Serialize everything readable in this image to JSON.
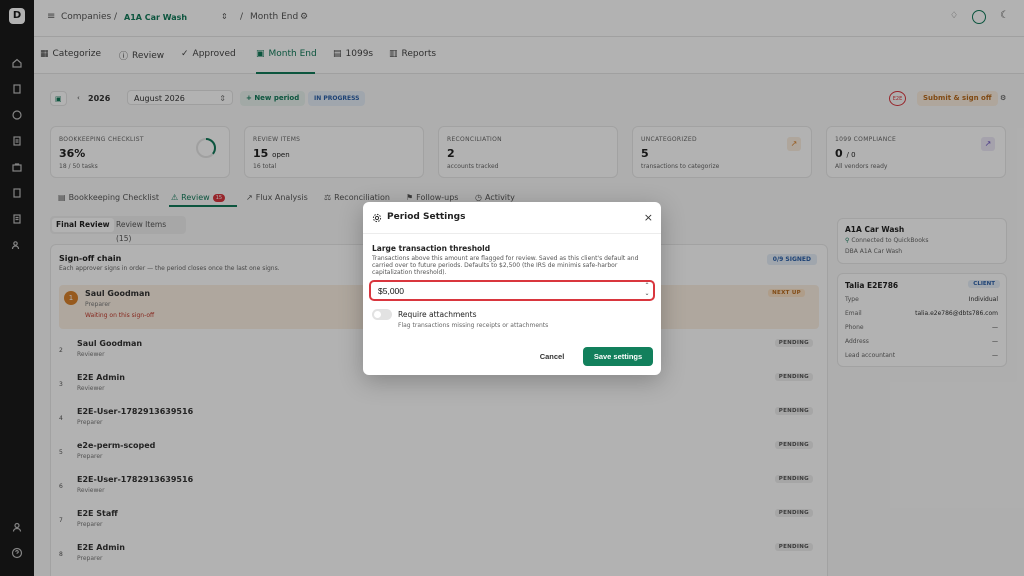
{
  "breadcrumb": {
    "companies": "Companies",
    "separator": "/",
    "company": "A1A Car Wash",
    "separator2": "/",
    "page": "Month End"
  },
  "tabs": [
    {
      "label": "Categorize"
    },
    {
      "label": "Review"
    },
    {
      "label": "Approved"
    },
    {
      "label": "Month End"
    },
    {
      "label": "1099s"
    },
    {
      "label": "Reports"
    }
  ],
  "period": {
    "year": "2026",
    "month": "August 2026",
    "new_period": "New period",
    "status": "IN PROGRESS",
    "avatar": "E2E",
    "submit": "Submit & sign off"
  },
  "cards": [
    {
      "label": "BOOKKEEPING CHECKLIST",
      "value": "36%",
      "sub": "18 / 50 tasks",
      "progress": 0.36
    },
    {
      "label": "REVIEW ITEMS",
      "value": "15",
      "value_suffix": "open",
      "sub": "16 total"
    },
    {
      "label": "RECONCILIATION",
      "value": "2",
      "sub": "accounts tracked"
    },
    {
      "label": "UNCATEGORIZED",
      "value": "5",
      "sub": "transactions to categorize"
    },
    {
      "label": "1099 COMPLIANCE",
      "value": "0",
      "value_suffix": "/ 0",
      "sub": "All vendors ready"
    }
  ],
  "subtabs": [
    {
      "label": "Bookkeeping Checklist"
    },
    {
      "label": "Review",
      "count": "15"
    },
    {
      "label": "Flux Analysis"
    },
    {
      "label": "Reconciliation"
    },
    {
      "label": "Follow-ups"
    },
    {
      "label": "Activity"
    }
  ],
  "review_tabs": {
    "final": "Final Review",
    "items": "Review Items (15)"
  },
  "signoff": {
    "title": "Sign-off chain",
    "subtitle": "Each approver signs in order — the period closes once the last one signs.",
    "signed": "0/9 SIGNED",
    "rows": [
      {
        "num": "1",
        "name": "Saul Goodman",
        "role": "Preparer",
        "waiting": "Waiting on this sign-off",
        "badge": "NEXT UP"
      },
      {
        "num": "2",
        "name": "Saul Goodman",
        "role": "Reviewer",
        "badge": "PENDING"
      },
      {
        "num": "3",
        "name": "E2E Admin",
        "role": "Reviewer",
        "badge": "PENDING"
      },
      {
        "num": "4",
        "name": "E2E-User-1782913639516",
        "role": "Preparer",
        "badge": "PENDING"
      },
      {
        "num": "5",
        "name": "e2e-perm-scoped",
        "role": "Preparer",
        "badge": "PENDING"
      },
      {
        "num": "6",
        "name": "E2E-User-1782913639516",
        "role": "Reviewer",
        "badge": "PENDING"
      },
      {
        "num": "7",
        "name": "E2E Staff",
        "role": "Preparer",
        "badge": "PENDING"
      },
      {
        "num": "8",
        "name": "E2E Admin",
        "role": "Preparer",
        "badge": "PENDING"
      }
    ]
  },
  "client": {
    "name": "A1A Car Wash",
    "connected": "Connected to QuickBooks",
    "dba": "DBA A1A Car Wash",
    "contact_name": "Talia E2E786",
    "badge": "CLIENT",
    "fields": [
      {
        "k": "Type",
        "v": "Individual"
      },
      {
        "k": "Email",
        "v": "talia.e2e786@dbts786.com"
      },
      {
        "k": "Phone",
        "v": "—"
      },
      {
        "k": "Address",
        "v": "—"
      },
      {
        "k": "Lead accountant",
        "v": "—"
      }
    ]
  },
  "modal": {
    "title": "Period Settings",
    "close": "×",
    "label": "Large transaction threshold",
    "help": "Transactions above this amount are flagged for review. Saved as this client's default and carried over to future periods. Defaults to $2,500 (the IRS de minimis safe-harbor capitalization threshold).",
    "value": "$5,000",
    "toggle_label": "Require attachments",
    "toggle_sub": "Flag transactions missing receipts or attachments",
    "toggle_on": false,
    "cancel": "Cancel",
    "save": "Save settings"
  },
  "colors": {
    "accent": "#127a5a",
    "danger": "#d9363e",
    "warning": "#d9822b"
  }
}
